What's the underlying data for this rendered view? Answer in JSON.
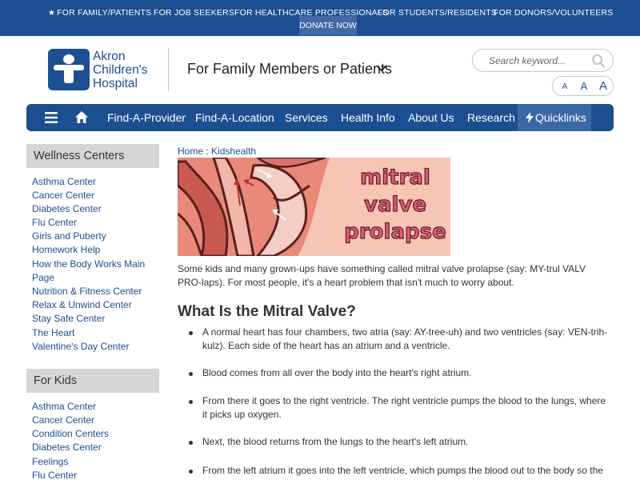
{
  "topbar": {
    "links": [
      "FOR FAMILY/PATIENTS",
      "FOR JOB SEEKERS",
      "FOR HEALTHCARE PROFESSIONALS",
      "FOR STUDENTS/RESIDENTS",
      "FOR DONORS/VOLUNTEERS"
    ],
    "donate": "DONATE NOW",
    "star_icon": "star-icon"
  },
  "header": {
    "logo_lines": [
      "Akron",
      "Children's",
      "Hospital"
    ],
    "audience": "For Family Members or Patients",
    "search_placeholder": "Search keyword...",
    "font_sizes": [
      "A",
      "A",
      "A"
    ]
  },
  "nav": {
    "items": [
      "Find-A-Provider",
      "Find-A-Location",
      "Services",
      "Health Info",
      "About Us",
      "Research"
    ],
    "quicklinks": "Quicklinks",
    "accent": "#1c4f91",
    "active": "#3a68a6"
  },
  "sidebar": {
    "wellness_title": "Wellness Centers",
    "wellness_items": [
      "Asthma Center",
      "Cancer Center",
      "Diabetes Center",
      "Flu Center",
      "Girls and Puberty",
      "Homework Help",
      "How the Body Works Main",
      "Page",
      "Nutrition & Fitness Center",
      "Relax & Unwind Center",
      "Stay Safe Center",
      "The Heart",
      "Valentine's Day Center"
    ],
    "kids_title": "For Kids",
    "kids_items": [
      "Asthma Center",
      "Cancer Center",
      "Condition Centers",
      "Diabetes Center",
      "Feelings",
      "Flu Center"
    ]
  },
  "content": {
    "breadcrumb_home": "Home",
    "breadcrumb_sep": ":",
    "breadcrumb_current": "Kidshealth",
    "hero_lines": [
      "mitral",
      "valve",
      "prolapse"
    ],
    "intro": "Some kids and many grown-ups have something called mitral valve prolapse (say: MY-trul VALV PRO-laps). For most people, it's a heart problem that isn't much to worry about.",
    "heading": "What Is the Mitral Valve?",
    "bullets": [
      "A normal heart has four chambers, two atria (say: AY-tree-uh) and two ventricles (say: VEN-trih-kulz). Each side of the heart has an atrium and a ventricle.",
      "Blood comes from all over the body into the heart's right atrium.",
      "From there it goes to the right ventricle. The right ventricle pumps the blood to the lungs, where it picks up oxygen.",
      "Next, the blood returns from the lungs to the heart's left atrium.",
      "From the left atrium it goes into the left ventricle, which pumps the blood out to the body so the"
    ]
  }
}
